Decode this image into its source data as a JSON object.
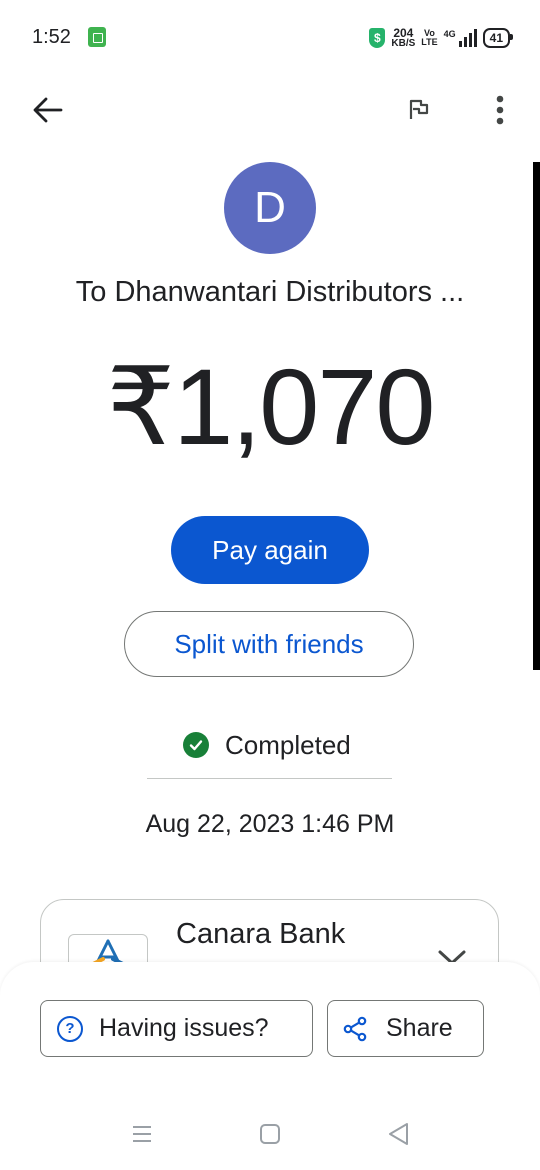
{
  "status_bar": {
    "time": "1:52",
    "net_speed_value": "204",
    "net_speed_unit": "KB/S",
    "volte_top": "Vo",
    "volte_bottom": "LTE",
    "signal_label": "4G",
    "battery": "41"
  },
  "top_bar": {
    "back_icon": "arrow-left-icon",
    "flag_icon": "flag-icon",
    "more_icon": "more-vert-icon"
  },
  "payee": {
    "initial": "D",
    "avatar_color": "#5c6bc0",
    "label": "To Dhanwantari Distributors ..."
  },
  "amount": "₹1,070",
  "actions": {
    "pay_again": "Pay again",
    "split": "Split with friends"
  },
  "transaction": {
    "status": "Completed",
    "status_color": "#188038",
    "datetime": "Aug 22, 2023 1:46 PM"
  },
  "bank": {
    "name": "Canara Bank"
  },
  "bottom_sheet": {
    "issues_label": "Having issues?",
    "share_label": "Share"
  },
  "colors": {
    "primary": "#0b57d0",
    "text": "#202124",
    "outline": "#747775"
  }
}
